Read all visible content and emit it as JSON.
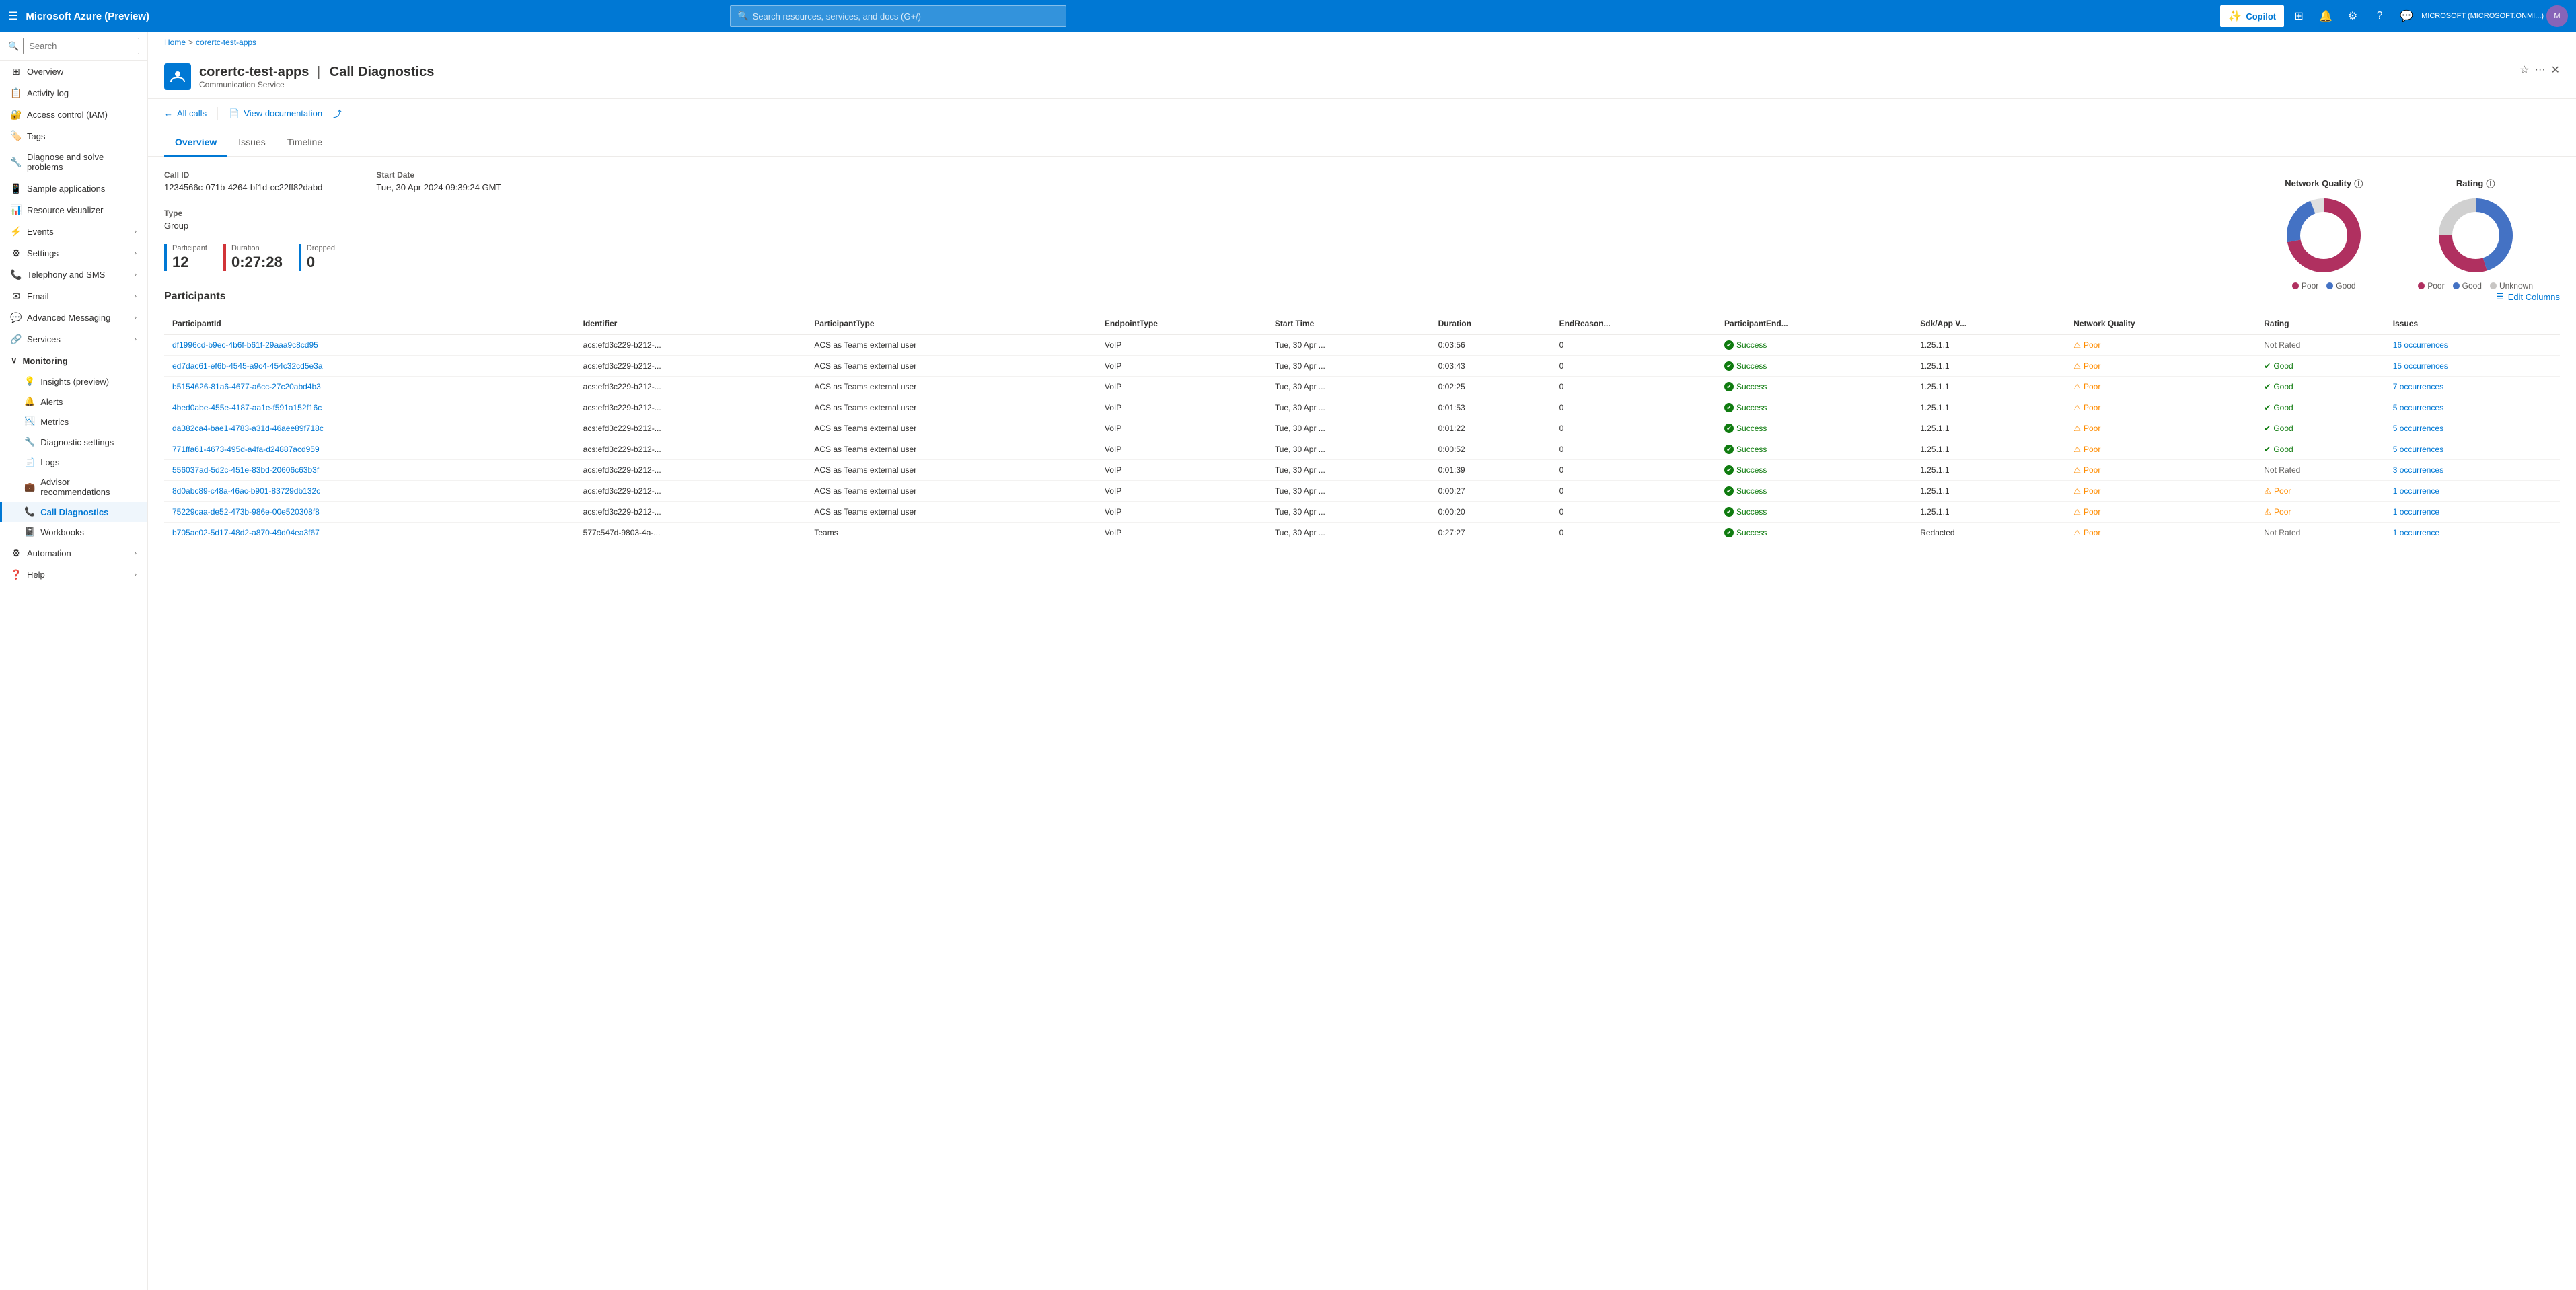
{
  "topNav": {
    "hamburgerIcon": "☰",
    "appTitle": "Microsoft Azure (Preview)",
    "searchPlaceholder": "Search resources, services, and docs (G+/)",
    "copilotLabel": "Copilot",
    "accountName": "MICROSOFT (MICROSOFT.ONMI...)"
  },
  "breadcrumb": {
    "home": "Home",
    "separator": ">",
    "resource": "corertc-test-apps"
  },
  "resourceHeader": {
    "name": "corertc-test-apps",
    "separator": "|",
    "page": "Call Diagnostics",
    "type": "Communication Service"
  },
  "toolbar": {
    "allCallsLabel": "All calls",
    "viewDocLabel": "View documentation"
  },
  "tabs": {
    "items": [
      {
        "label": "Overview",
        "active": true
      },
      {
        "label": "Issues",
        "active": false
      },
      {
        "label": "Timeline",
        "active": false
      }
    ]
  },
  "callInfo": {
    "callIdLabel": "Call ID",
    "callIdValue": "1234566c-071b-4264-bf1d-cc22ff82dabd",
    "startDateLabel": "Start Date",
    "startDateValue": "Tue, 30 Apr 2024 09:39:24 GMT",
    "typeLabel": "Type",
    "typeValue": "Group"
  },
  "stats": {
    "participant": {
      "label": "Participant",
      "value": "12"
    },
    "duration": {
      "label": "Duration",
      "value": "0:27:28"
    },
    "dropped": {
      "label": "Dropped",
      "value": "0"
    }
  },
  "charts": {
    "networkQuality": {
      "title": "Network Quality",
      "poorPercent": 72,
      "goodPercent": 22,
      "otherPercent": 6,
      "poorColor": "#b03060",
      "goodColor": "#4472c4",
      "otherColor": "#e0e0e0",
      "legend": [
        {
          "label": "Poor",
          "color": "#b03060"
        },
        {
          "label": "Good",
          "color": "#4472c4"
        }
      ]
    },
    "rating": {
      "title": "Rating",
      "poorPercent": 30,
      "goodPercent": 45,
      "unknownPercent": 25,
      "poorColor": "#b03060",
      "goodColor": "#4472c4",
      "unknownColor": "#e0e0e0",
      "legend": [
        {
          "label": "Poor",
          "color": "#b03060"
        },
        {
          "label": "Good",
          "color": "#4472c4"
        },
        {
          "label": "Unknown",
          "color": "#c8c6c4"
        }
      ]
    }
  },
  "participants": {
    "sectionTitle": "Participants",
    "editColumnsLabel": "Edit Columns",
    "columns": [
      "ParticipantId",
      "Identifier",
      "ParticipantType",
      "EndpointType",
      "Start Time",
      "Duration",
      "EndReason...",
      "ParticipantEnd...",
      "Sdk/App V...",
      "Network Quality",
      "Rating",
      "Issues"
    ],
    "rows": [
      {
        "participantId": "df1996cd-b9ec-4b6f-b61f-29aaa9c8cd95",
        "identifier": "acs:efd3c229-b212-...",
        "participantType": "ACS as Teams external user",
        "endpointType": "VoIP",
        "startTime": "Tue, 30 Apr ...",
        "duration": "0:03:56",
        "endReason": "0",
        "participantEnd": "Success",
        "sdkAppV": "1.25.1.1",
        "networkQuality": "Poor",
        "rating": "Not Rated",
        "issues": "16 occurrences"
      },
      {
        "participantId": "ed7dac61-ef6b-4545-a9c4-454c32cd5e3a",
        "identifier": "acs:efd3c229-b212-...",
        "participantType": "ACS as Teams external user",
        "endpointType": "VoIP",
        "startTime": "Tue, 30 Apr ...",
        "duration": "0:03:43",
        "endReason": "0",
        "participantEnd": "Success",
        "sdkAppV": "1.25.1.1",
        "networkQuality": "Poor",
        "rating": "Good",
        "issues": "15 occurrences"
      },
      {
        "participantId": "b5154626-81a6-4677-a6cc-27c20abd4b3",
        "identifier": "acs:efd3c229-b212-...",
        "participantType": "ACS as Teams external user",
        "endpointType": "VoIP",
        "startTime": "Tue, 30 Apr ...",
        "duration": "0:02:25",
        "endReason": "0",
        "participantEnd": "Success",
        "sdkAppV": "1.25.1.1",
        "networkQuality": "Poor",
        "rating": "Good",
        "issues": "7 occurrences"
      },
      {
        "participantId": "4bed0abe-455e-4187-aa1e-f591a152f16c",
        "identifier": "acs:efd3c229-b212-...",
        "participantType": "ACS as Teams external user",
        "endpointType": "VoIP",
        "startTime": "Tue, 30 Apr ...",
        "duration": "0:01:53",
        "endReason": "0",
        "participantEnd": "Success",
        "sdkAppV": "1.25.1.1",
        "networkQuality": "Poor",
        "rating": "Good",
        "issues": "5 occurrences"
      },
      {
        "participantId": "da382ca4-bae1-4783-a31d-46aee89f718c",
        "identifier": "acs:efd3c229-b212-...",
        "participantType": "ACS as Teams external user",
        "endpointType": "VoIP",
        "startTime": "Tue, 30 Apr ...",
        "duration": "0:01:22",
        "endReason": "0",
        "participantEnd": "Success",
        "sdkAppV": "1.25.1.1",
        "networkQuality": "Poor",
        "rating": "Good",
        "issues": "5 occurrences"
      },
      {
        "participantId": "771ffa61-4673-495d-a4fa-d24887acd959",
        "identifier": "acs:efd3c229-b212-...",
        "participantType": "ACS as Teams external user",
        "endpointType": "VoIP",
        "startTime": "Tue, 30 Apr ...",
        "duration": "0:00:52",
        "endReason": "0",
        "participantEnd": "Success",
        "sdkAppV": "1.25.1.1",
        "networkQuality": "Poor",
        "rating": "Good",
        "issues": "5 occurrences"
      },
      {
        "participantId": "556037ad-5d2c-451e-83bd-20606c63b3f",
        "identifier": "acs:efd3c229-b212-...",
        "participantType": "ACS as Teams external user",
        "endpointType": "VoIP",
        "startTime": "Tue, 30 Apr ...",
        "duration": "0:01:39",
        "endReason": "0",
        "participantEnd": "Success",
        "sdkAppV": "1.25.1.1",
        "networkQuality": "Poor",
        "rating": "Not Rated",
        "issues": "3 occurrences"
      },
      {
        "participantId": "8d0abc89-c48a-46ac-b901-83729db132c",
        "identifier": "acs:efd3c229-b212-...",
        "participantType": "ACS as Teams external user",
        "endpointType": "VoIP",
        "startTime": "Tue, 30 Apr ...",
        "duration": "0:00:27",
        "endReason": "0",
        "participantEnd": "Success",
        "sdkAppV": "1.25.1.1",
        "networkQuality": "Poor",
        "rating": "Poor",
        "issues": "1 occurrence"
      },
      {
        "participantId": "75229caa-de52-473b-986e-00e520308f8",
        "identifier": "acs:efd3c229-b212-...",
        "participantType": "ACS as Teams external user",
        "endpointType": "VoIP",
        "startTime": "Tue, 30 Apr ...",
        "duration": "0:00:20",
        "endReason": "0",
        "participantEnd": "Success",
        "sdkAppV": "1.25.1.1",
        "networkQuality": "Poor",
        "rating": "Poor",
        "issues": "1 occurrence"
      },
      {
        "participantId": "b705ac02-5d17-48d2-a870-49d04ea3f67",
        "identifier": "577c547d-9803-4a-...",
        "participantType": "Teams",
        "endpointType": "VoIP",
        "startTime": "Tue, 30 Apr ...",
        "duration": "0:27:27",
        "endReason": "0",
        "participantEnd": "Success",
        "sdkAppV": "Redacted",
        "networkQuality": "Poor",
        "rating": "Not Rated",
        "issues": "1 occurrence"
      }
    ]
  },
  "sidebar": {
    "searchPlaceholder": "Search",
    "items": [
      {
        "label": "Overview",
        "icon": "⊞",
        "type": "item"
      },
      {
        "label": "Activity log",
        "icon": "📋",
        "type": "item"
      },
      {
        "label": "Access control (IAM)",
        "icon": "🔐",
        "type": "item"
      },
      {
        "label": "Tags",
        "icon": "🏷️",
        "type": "item"
      },
      {
        "label": "Diagnose and solve problems",
        "icon": "🔧",
        "type": "item"
      },
      {
        "label": "Sample applications",
        "icon": "📱",
        "type": "item"
      },
      {
        "label": "Resource visualizer",
        "icon": "📊",
        "type": "item"
      },
      {
        "label": "Events",
        "icon": "⚡",
        "type": "expandable"
      },
      {
        "label": "Settings",
        "icon": "⚙",
        "type": "expandable"
      },
      {
        "label": "Telephony and SMS",
        "icon": "📞",
        "type": "expandable"
      },
      {
        "label": "Email",
        "icon": "✉",
        "type": "expandable"
      },
      {
        "label": "Advanced Messaging",
        "icon": "💬",
        "type": "expandable"
      },
      {
        "label": "Services",
        "icon": "🔗",
        "type": "expandable"
      },
      {
        "label": "Monitoring",
        "icon": "📈",
        "type": "section",
        "expanded": true
      },
      {
        "label": "Insights (preview)",
        "icon": "💡",
        "type": "subitem"
      },
      {
        "label": "Alerts",
        "icon": "🔔",
        "type": "subitem"
      },
      {
        "label": "Metrics",
        "icon": "📉",
        "type": "subitem"
      },
      {
        "label": "Diagnostic settings",
        "icon": "🔧",
        "type": "subitem"
      },
      {
        "label": "Logs",
        "icon": "📄",
        "type": "subitem"
      },
      {
        "label": "Advisor recommendations",
        "icon": "💼",
        "type": "subitem"
      },
      {
        "label": "Call Diagnostics",
        "icon": "📞",
        "type": "subitem",
        "active": true
      },
      {
        "label": "Workbooks",
        "icon": "📓",
        "type": "subitem"
      },
      {
        "label": "Automation",
        "icon": "⚙",
        "type": "expandable"
      },
      {
        "label": "Help",
        "icon": "?",
        "type": "expandable"
      }
    ]
  }
}
